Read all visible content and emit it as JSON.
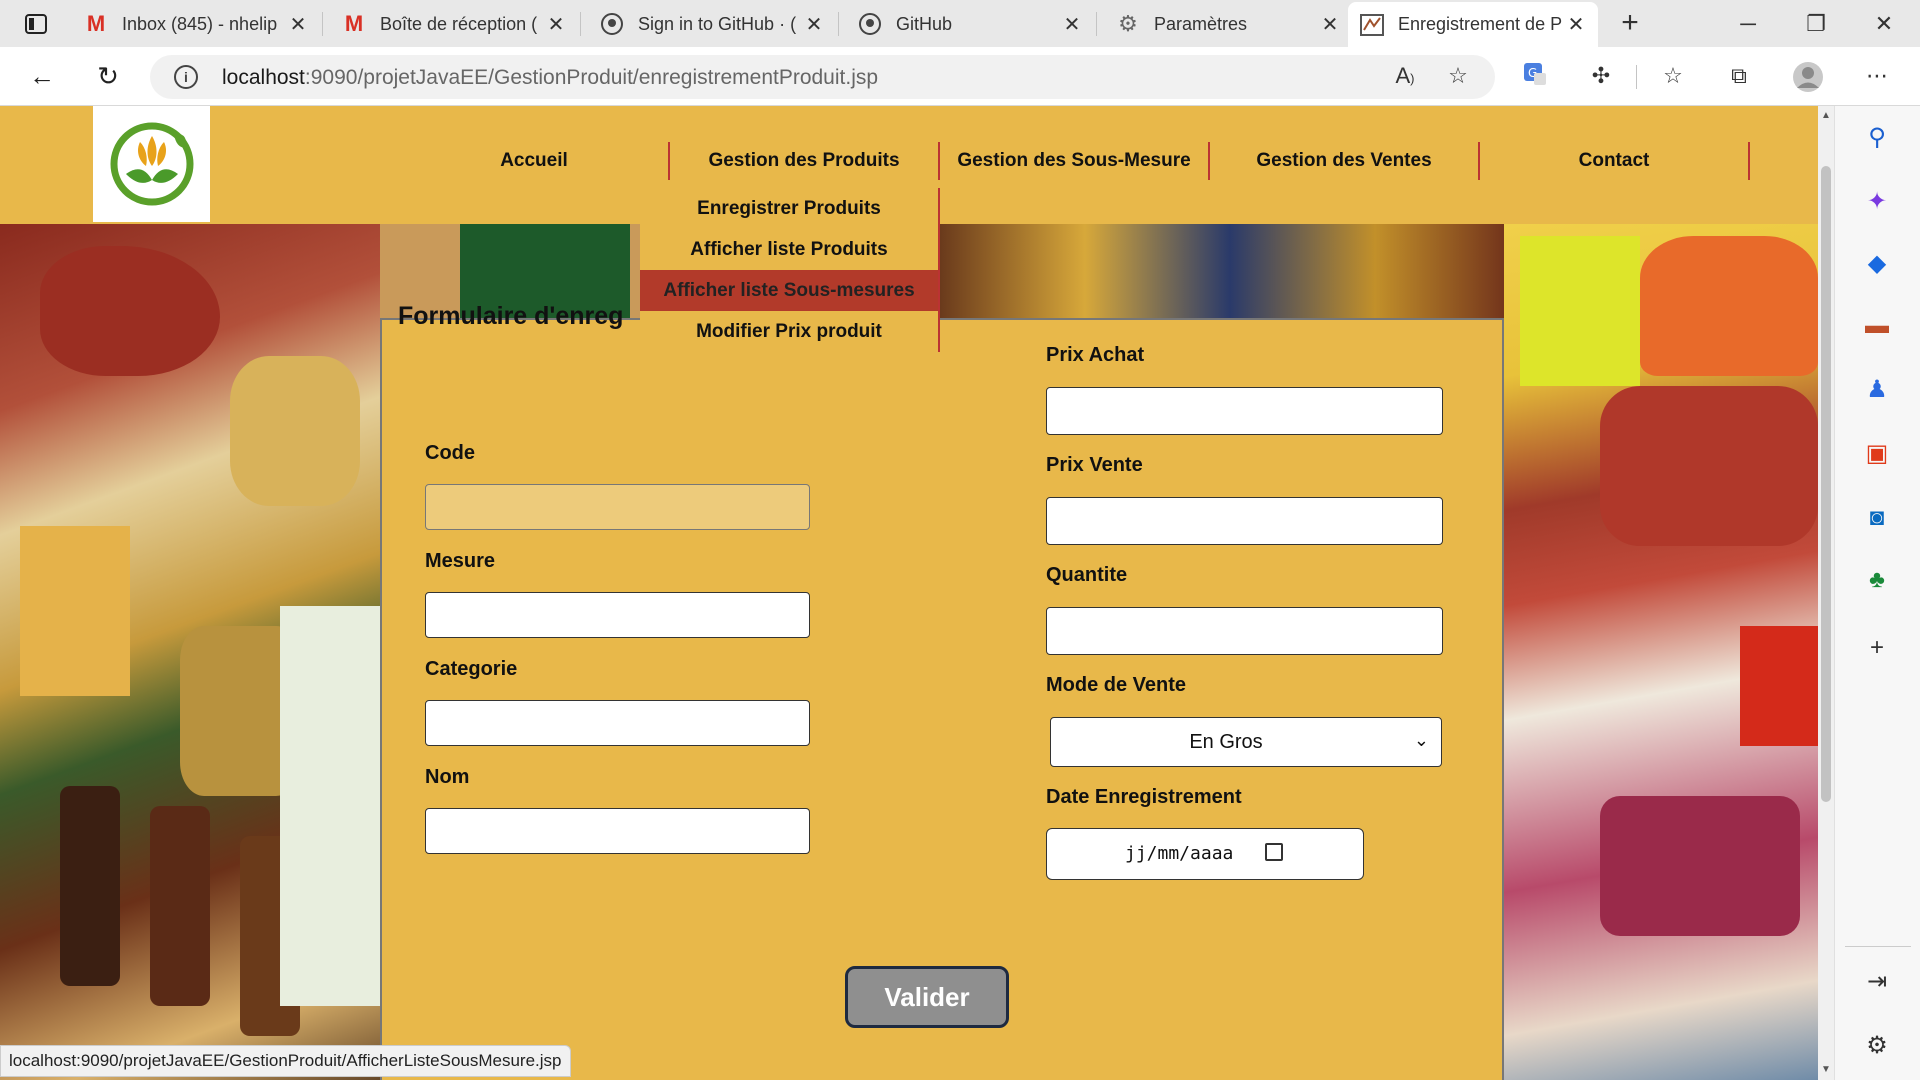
{
  "browser": {
    "tabs": [
      {
        "title": "Inbox (845) - nhelip",
        "icon": "gmail-icon",
        "active": false
      },
      {
        "title": "Boîte de réception (",
        "icon": "gmail-icon",
        "active": false
      },
      {
        "title": "Sign in to GitHub · (",
        "icon": "github-icon",
        "active": false
      },
      {
        "title": "GitHub",
        "icon": "github-icon",
        "active": false
      },
      {
        "title": "Paramètres",
        "icon": "gear-icon",
        "active": false
      },
      {
        "title": "Enregistrement de P",
        "icon": "page-icon",
        "active": true
      }
    ],
    "url_host": "localhost",
    "url_path": ":9090/projetJavaEE/GestionProduit/enregistrementProduit.jsp",
    "status_url": "localhost:9090/projetJavaEE/GestionProduit/AfficherListeSousMesure.jsp"
  },
  "nav": {
    "items": [
      "Accueil",
      "Gestion des Produits",
      "Gestion des Sous-Mesure",
      "Gestion des Ventes",
      "Contact"
    ],
    "dropdown": [
      "Enregistrer Produits",
      "Afficher liste Produits",
      "Afficher liste Sous-mesures",
      "Modifier Prix produit"
    ]
  },
  "form": {
    "title": "Formulaire d'enreg",
    "left_labels": [
      "Code",
      "Mesure",
      "Categorie",
      "Nom"
    ],
    "right_labels": [
      "Prix Achat",
      "Prix Vente",
      "Quantite",
      "Mode de Vente",
      "Date Enregistrement"
    ],
    "mode_vente_value": "En Gros",
    "date_placeholder": "jj/mm/aaaa",
    "submit_label": "Valider"
  },
  "colors": {
    "header": "#e8b84a",
    "menu_hover": "#b23a2a",
    "nav_separator": "#b33333"
  }
}
